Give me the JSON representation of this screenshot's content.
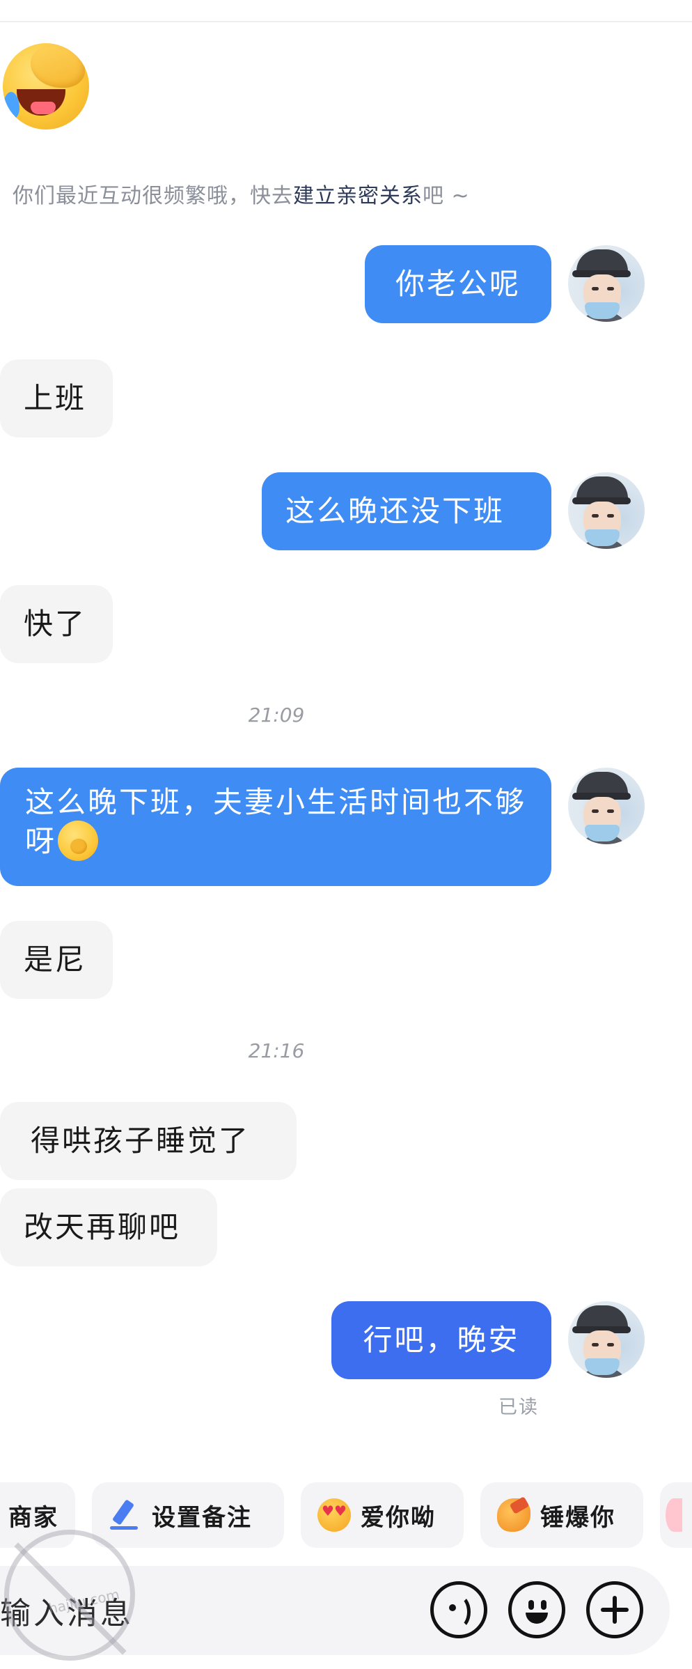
{
  "system_tip": {
    "prefix": "你们最近互动很频繁哦，快去",
    "link": "建立亲密关系",
    "suffix": "吧 ~"
  },
  "messages": [
    {
      "side": "out",
      "text": "你老公呢"
    },
    {
      "side": "in",
      "text": "上班"
    },
    {
      "side": "out",
      "text": "这么晚还没下班"
    },
    {
      "side": "in",
      "text": "快了"
    },
    {
      "side": "time",
      "text": "21:09"
    },
    {
      "side": "out",
      "text": "这么晚下班，夫妻小生活时间也不够呀"
    },
    {
      "side": "in",
      "text": "是尼"
    },
    {
      "side": "time",
      "text": "21:16"
    },
    {
      "side": "in",
      "text": "得哄孩子睡觉了"
    },
    {
      "side": "in",
      "text": "改天再聊吧"
    },
    {
      "side": "out",
      "text": "行吧，晚安"
    }
  ],
  "read_status": "已读",
  "quick_actions": [
    {
      "label": "商家",
      "icon": "shop-icon"
    },
    {
      "label": "设置备注",
      "icon": "pen-icon"
    },
    {
      "label": "爱你呦",
      "icon": "love-emoji-icon"
    },
    {
      "label": "锤爆你",
      "icon": "hammer-emoji-icon"
    }
  ],
  "input": {
    "placeholder": "输入消息"
  },
  "watermark": "hajilu.com",
  "colors": {
    "outgoing": "#3f8cf4",
    "incoming": "#f4f4f5",
    "accent_link": "#2d3a5a"
  }
}
